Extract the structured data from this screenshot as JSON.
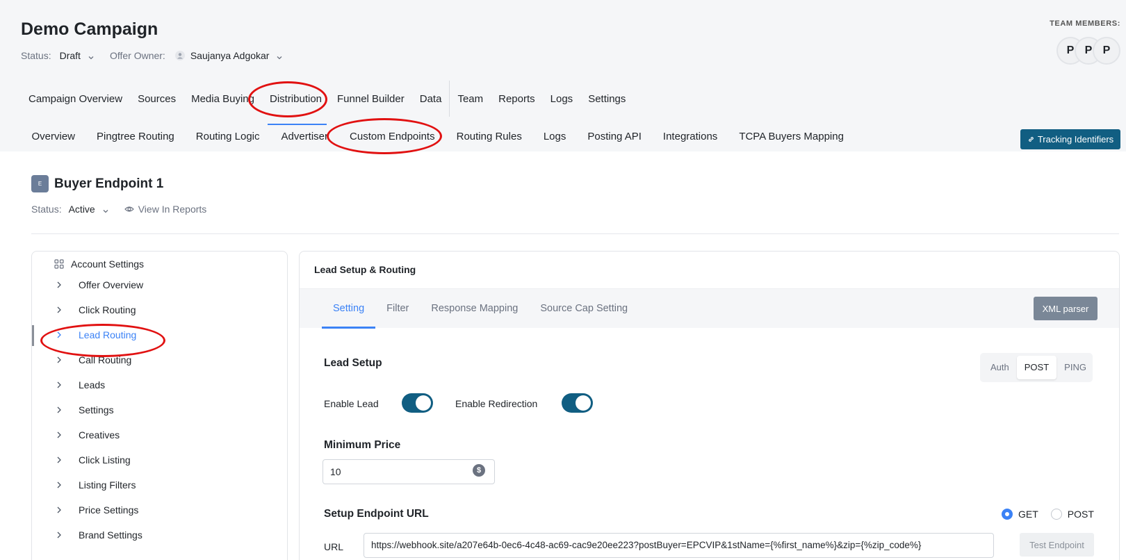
{
  "header": {
    "title": "Demo Campaign",
    "status_label": "Status:",
    "status_value": "Draft",
    "owner_label": "Offer Owner:",
    "owner_value": "Saujanya Adgokar",
    "team_label": "TEAM MEMBERS:",
    "avatars": [
      "P",
      "P",
      "P"
    ]
  },
  "main_tabs": [
    {
      "label": "Campaign Overview"
    },
    {
      "label": "Sources"
    },
    {
      "label": "Media Buying"
    },
    {
      "label": "Distribution",
      "active": true
    },
    {
      "label": "Funnel Builder"
    },
    {
      "label": "Data"
    },
    {
      "label": "Team"
    },
    {
      "label": "Reports"
    },
    {
      "label": "Logs"
    },
    {
      "label": "Settings"
    }
  ],
  "sub_tabs": [
    {
      "label": "Overview"
    },
    {
      "label": "Pingtree Routing"
    },
    {
      "label": "Routing Logic"
    },
    {
      "label": "Advertiser"
    },
    {
      "label": "Custom Endpoints",
      "active": true
    },
    {
      "label": "Routing Rules"
    },
    {
      "label": "Logs"
    },
    {
      "label": "Posting API"
    },
    {
      "label": "Integrations"
    },
    {
      "label": "TCPA Buyers Mapping"
    }
  ],
  "tracking_button": "Tracking Identifiers",
  "endpoint": {
    "badge": "E",
    "title": "Buyer Endpoint 1",
    "status_label": "Status:",
    "status_value": "Active",
    "view_reports": "View In Reports"
  },
  "sidebar": {
    "heading": "Account Settings",
    "items": [
      {
        "label": "Offer Overview"
      },
      {
        "label": "Click Routing"
      },
      {
        "label": "Lead Routing",
        "active": true
      },
      {
        "label": "Call Routing"
      },
      {
        "label": "Leads"
      },
      {
        "label": "Settings"
      },
      {
        "label": "Creatives"
      },
      {
        "label": "Click Listing"
      },
      {
        "label": "Listing Filters"
      },
      {
        "label": "Price Settings"
      },
      {
        "label": "Brand Settings"
      }
    ]
  },
  "panel": {
    "title": "Lead Setup & Routing",
    "tabs": [
      {
        "label": "Setting",
        "active": true
      },
      {
        "label": "Filter"
      },
      {
        "label": "Response Mapping"
      },
      {
        "label": "Source Cap Setting"
      }
    ],
    "xml_button": "XML parser",
    "lead_setup_title": "Lead Setup",
    "mode_options": [
      "Auth",
      "POST",
      "PING"
    ],
    "mode_selected": "POST",
    "enable_lead_label": "Enable Lead",
    "enable_lead_on": true,
    "enable_redirection_label": "Enable Redirection",
    "enable_redirection_on": true,
    "min_price_title": "Minimum Price",
    "min_price_value": "10",
    "currency_symbol": "$",
    "endpoint_url_title": "Setup Endpoint URL",
    "method_options": [
      "GET",
      "POST"
    ],
    "method_selected": "GET",
    "url_label": "URL",
    "url_value": "https://webhook.site/a207e64b-0ec6-4c48-ac69-cac9e20ee223?postBuyer=EPCVIP&1stName={%first_name%}&zip={%zip_code%}",
    "test_button": "Test Endpoint"
  },
  "annotation_color": "#e11111",
  "accent_color": "#115e82"
}
